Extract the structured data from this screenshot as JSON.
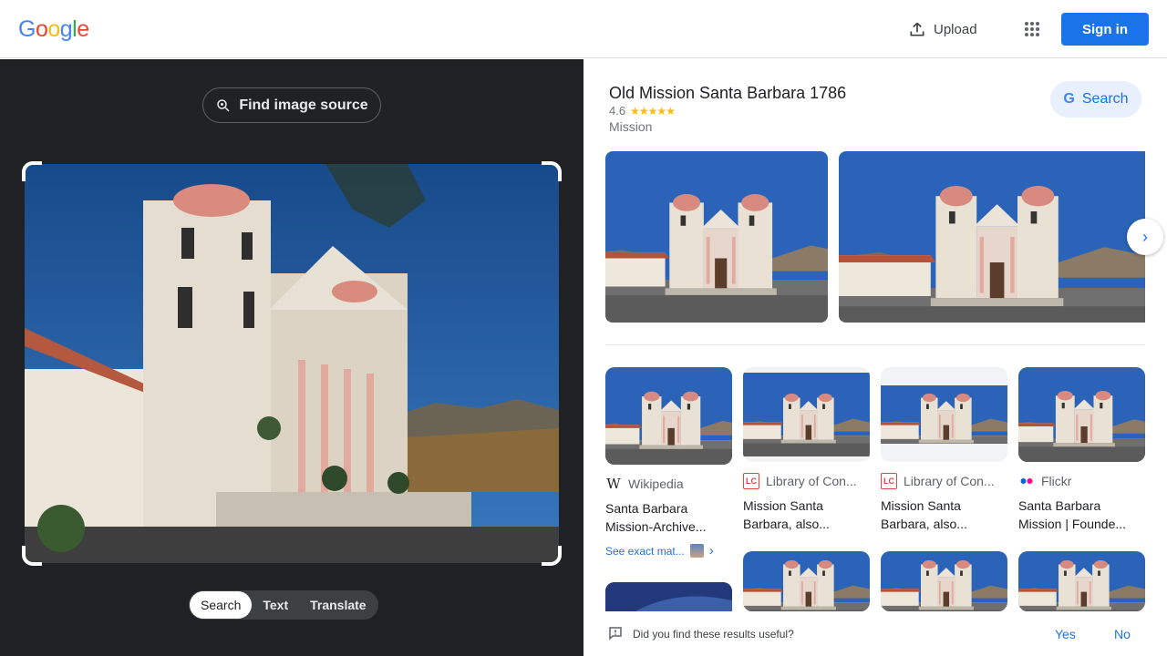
{
  "header": {
    "logo_letters": [
      "G",
      "o",
      "o",
      "g",
      "l",
      "e"
    ],
    "upload_label": "Upload",
    "apps_icon": "apps-grid-icon",
    "signin_label": "Sign in"
  },
  "lens": {
    "find_source_label": "Find image source",
    "modes": [
      "Search",
      "Text",
      "Translate"
    ],
    "active_mode": "Search"
  },
  "knowledge_panel": {
    "title": "Old Mission Santa Barbara 1786",
    "rating": "4.6",
    "stars": "★★★★★",
    "type": "Mission",
    "search_button": "Search"
  },
  "results": [
    {
      "source": "Wikipedia",
      "title": "Santa Barbara Mission-Archive...",
      "exact_match": "See exact mat..."
    },
    {
      "source": "Library of Con...",
      "title": "Mission Santa Barbara, also..."
    },
    {
      "source": "Library of Con...",
      "title": "Mission Santa Barbara, also..."
    },
    {
      "source": "Flickr",
      "title": "Santa Barbara Mission | Founde..."
    }
  ],
  "feedback": {
    "question": "Did you find these results useful?",
    "yes": "Yes",
    "no": "No"
  },
  "colors": {
    "accent": "#1a73e8",
    "dark_panel": "#202124",
    "star": "#fbbc04"
  }
}
